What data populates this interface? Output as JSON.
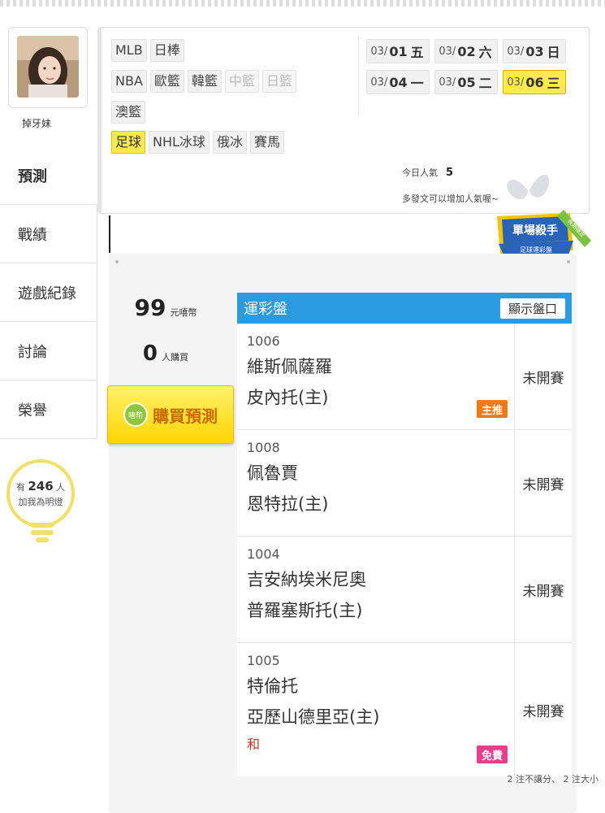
{
  "profile": {
    "username": "掉牙妹"
  },
  "side_nav": [
    {
      "label": "預測",
      "active": true
    },
    {
      "label": "戰績"
    },
    {
      "label": "遊戲紀錄"
    },
    {
      "label": "討論"
    },
    {
      "label": "榮譽"
    }
  ],
  "fans": {
    "prefix": "有",
    "count": "246",
    "unit": "人",
    "caption": "加我為明燈"
  },
  "sports": {
    "row1": [
      "MLB",
      "日棒"
    ],
    "row2": [
      "NBA",
      "歐籃",
      "韓籃",
      "中籃",
      "日籃"
    ],
    "row3": [
      "澳籃"
    ],
    "row4": [
      "足球",
      "NHL冰球",
      "俄冰",
      "賽馬"
    ]
  },
  "dates": [
    {
      "md": "03/",
      "d": "01",
      "w": "五"
    },
    {
      "md": "03/",
      "d": "02",
      "w": "六"
    },
    {
      "md": "03/",
      "d": "03",
      "w": "日"
    },
    {
      "md": "03/",
      "d": "04",
      "w": "一"
    },
    {
      "md": "03/",
      "d": "05",
      "w": "二"
    },
    {
      "md": "03/",
      "d": "06",
      "w": "三",
      "selected": true
    }
  ],
  "popularity": {
    "label": "今日人氣",
    "value": "5",
    "hint": "多發文可以增加人氣喔~"
  },
  "badge": {
    "line1": "單場殺手",
    "line2": "足球運彩盤",
    "corner": "長期穩定"
  },
  "price": {
    "value": "99",
    "unit": "元嘻幣"
  },
  "buyers": {
    "value": "0",
    "unit": "人購買"
  },
  "buy_button": {
    "label": "購買預測",
    "icon_text": "嘻幣"
  },
  "table": {
    "title": "運彩盤",
    "show_button": "顯示盤口",
    "games": [
      {
        "no": "1006",
        "away": "維斯佩薩羅",
        "home": "皮內托(主)",
        "status": "未開賽",
        "tag": "主推",
        "tag_color": "#ef7a1e",
        "pick": ""
      },
      {
        "no": "1008",
        "away": "佩魯賈",
        "home": "恩特拉(主)",
        "status": "未開賽",
        "tag": "",
        "pick": ""
      },
      {
        "no": "1004",
        "away": "吉安納埃米尼奧",
        "home": "普羅塞斯托(主)",
        "status": "未開賽",
        "tag": "",
        "pick": ""
      },
      {
        "no": "1005",
        "away": "特倫托",
        "home": "亞歷山德里亞(主)",
        "status": "未開賽",
        "tag": "免費",
        "tag_color": "#e83e8c",
        "pick": "和"
      }
    ],
    "footer": "2 注不讓分、 2 注大小"
  }
}
